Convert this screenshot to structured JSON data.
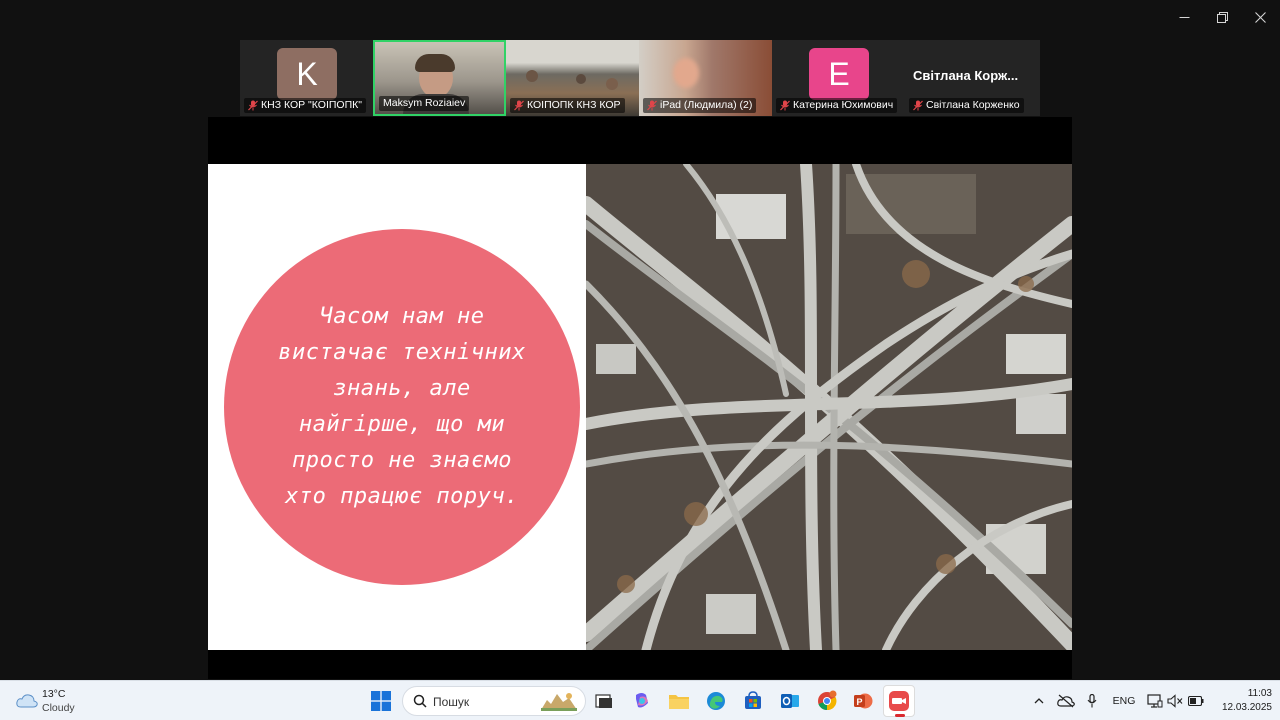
{
  "participants": [
    {
      "label": "КНЗ КОР \"КОІПОПК\"",
      "avatar_letter": "K",
      "avatar_color": "#8e6e62",
      "muted": true
    },
    {
      "label": "Maksym Roziaiev",
      "muted": false,
      "active_speaker": true
    },
    {
      "label": "КОІПОПК КНЗ КОР",
      "muted": true
    },
    {
      "label": "iPad (Людмила) (2)",
      "muted": true
    },
    {
      "label": "Катерина Юхимович",
      "avatar_letter": "E",
      "avatar_color": "#e8458b",
      "muted": true
    },
    {
      "label": "Світлана Корженко",
      "display_name": "Світлана Корж...",
      "muted": true
    }
  ],
  "slide": {
    "quote_lines": [
      "Часом нам не",
      "вистачає технічних",
      "знань, але",
      "найгірше, що ми",
      "просто не знаємо",
      "хто працює поруч."
    ],
    "circle_color": "#ec6b77"
  },
  "taskbar": {
    "weather": {
      "temp": "13°C",
      "condition": "Cloudy"
    },
    "search_placeholder": "Пошук",
    "language": "ENG",
    "time": "11:03",
    "date": "12.03.2025",
    "pinned_apps": [
      "windows-start",
      "file-explorer",
      "copilot",
      "folder",
      "edge",
      "store",
      "outlook",
      "chrome",
      "powerpoint",
      "zoom"
    ]
  },
  "colors": {
    "active_speaker_border": "#31d266",
    "app_background": "#111111",
    "tile_background": "#242424"
  }
}
